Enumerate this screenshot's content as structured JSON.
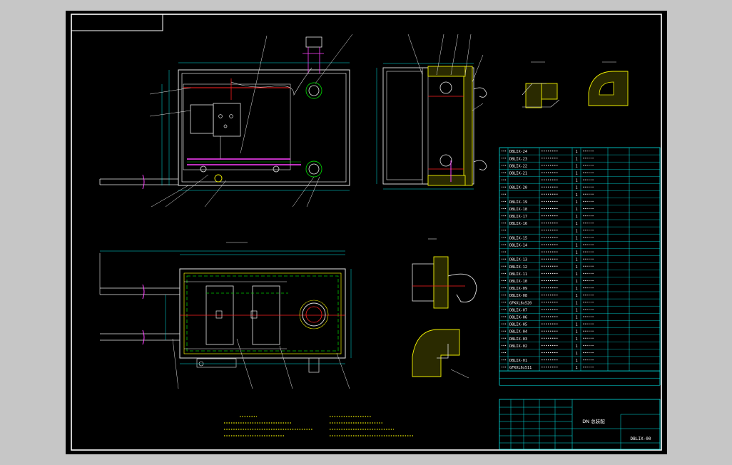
{
  "colors": {
    "background": "#c6c6c6",
    "paper": "#000000",
    "frame": "#ffffff",
    "outline": "#e6e6e6",
    "cyan": "#00e5e5",
    "yellow": "#f0f000",
    "green": "#00c800",
    "red": "#ff2020",
    "magenta": "#ff40ff"
  },
  "title_block": {
    "drawing_name": "DN 总装配",
    "drawing_number": "DBLIX-00"
  },
  "parts_list": [
    {
      "code": "DBLIX-24",
      "qty": "1"
    },
    {
      "code": "DBLIX-23",
      "qty": "1"
    },
    {
      "code": "DBLIX-22",
      "qty": "1"
    },
    {
      "code": "DBLIX-21",
      "qty": "1"
    },
    {
      "code": "",
      "qty": "1"
    },
    {
      "code": "DBLIX-20",
      "qty": "1"
    },
    {
      "code": "",
      "qty": "1"
    },
    {
      "code": "DBLIX-19",
      "qty": "1"
    },
    {
      "code": "DBLIX-18",
      "qty": "1"
    },
    {
      "code": "DBLIX-17",
      "qty": "1"
    },
    {
      "code": "DBLIX-16",
      "qty": "1"
    },
    {
      "code": "",
      "qty": "1"
    },
    {
      "code": "DBLIX-15",
      "qty": "1"
    },
    {
      "code": "DBLIX-14",
      "qty": "1"
    },
    {
      "code": "",
      "qty": "1"
    },
    {
      "code": "DBLIX-13",
      "qty": "1"
    },
    {
      "code": "DBLIX-12",
      "qty": "1"
    },
    {
      "code": "DBLIX-11",
      "qty": "1"
    },
    {
      "code": "DBLIX-10",
      "qty": "1"
    },
    {
      "code": "DBLIX-09",
      "qty": "1"
    },
    {
      "code": "DBLIX-08",
      "qty": "1"
    },
    {
      "code": "GFKXL6x520",
      "qty": "1"
    },
    {
      "code": "DBLIX-07",
      "qty": "1"
    },
    {
      "code": "DBLIX-06",
      "qty": "1"
    },
    {
      "code": "DBLIX-05",
      "qty": "1"
    },
    {
      "code": "DBLIX-04",
      "qty": "1"
    },
    {
      "code": "DBLIX-03",
      "qty": "1"
    },
    {
      "code": "DBLIX-02",
      "qty": "1"
    },
    {
      "code": "",
      "qty": "1"
    },
    {
      "code": "DBLIX-01",
      "qty": "1"
    },
    {
      "code": "GFKXL6x511",
      "qty": "1"
    }
  ]
}
